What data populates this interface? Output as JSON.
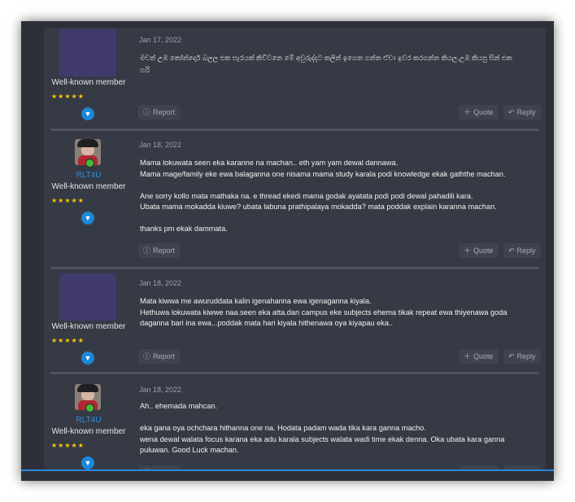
{
  "buttons": {
    "report": "Report",
    "quote": "Quote",
    "reply": "Reply"
  },
  "icons": {
    "report": "info-circle-icon",
    "quote": "plus-icon",
    "reply": "reply-arrow-icon",
    "expand": "chevron-down-icon",
    "star": "star-icon"
  },
  "colors": {
    "username": "#2f8fe0",
    "stars": "#ffcc00",
    "expand": "#1b87d8",
    "online": "#44bb33"
  },
  "posts": [
    {
      "username": "",
      "user_title": "Well-known member",
      "rating": 5,
      "date": "Jan 17, 2022",
      "lines": [
        "මචන් උඹ කෝන්දොර් බලල එක සැරයක් කිව්වනෙ මේ අවුරුද්දට කලින් ඉගෙන ගන්න ඒවා ඉවර කරගන්න කියල.උඹ කියපු සින් එක",
        "හරි"
      ]
    },
    {
      "username": "RLT4U",
      "user_title": "Well-known member",
      "rating": 5,
      "date": "Jan 18, 2022",
      "lines": [
        "Mama lokuwata seen eka karanne na machan.. eth yam yam dewal dannawa.",
        "Mama mage/family eke ewa balaganna one nisama mama study karala podi knowledge ekak gaththe machan.",
        "",
        "Ane sorry kollo mata mathaka na. e thread ekedi mama godak ayatata podi podi dewal pahadili kara.",
        "Ubata mama mokadda kiuwe? ubata labuna prathipalaya mokadda? mata poddak explain karanna machan.",
        "",
        "thanks pm ekak dammata."
      ]
    },
    {
      "username": "",
      "user_title": "Well-known member",
      "rating": 5,
      "date": "Jan 18, 2022",
      "lines": [
        "Mata kiwwa me awuruddata kalin igenahanna ewa igenaganna kiyala.",
        "Hethuwa lokuwata kiwwe naa.seen eka atta.dan campus eke subjects ehema tikak repeat ewa thiyenawa goda",
        "daganna bari ina ewa...poddak mata hari kiyala hithenawa oya kiyapau eka.."
      ]
    },
    {
      "username": "RLT4U",
      "user_title": "Well-known member",
      "rating": 5,
      "date": "Jan 18, 2022",
      "lines": [
        "Ah.. ehemada mahcan.",
        "",
        "eka gana oya ochchara hithanna one na. Hodata padam wada tika kara ganna macho.",
        "wena dewal walata focus karana eka adu karala subjects walata wadi time ekak denna. Oka ubata kara ganna",
        "puluwan. Good Luck machan."
      ]
    }
  ]
}
